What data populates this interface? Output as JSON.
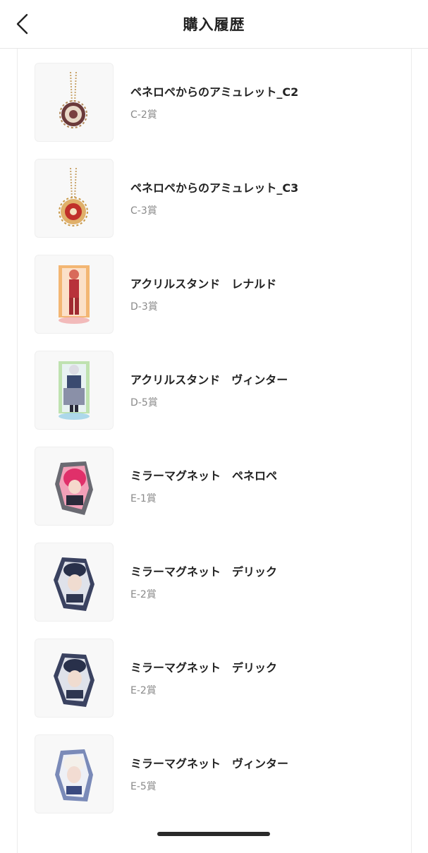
{
  "header": {
    "title": "購入履歴",
    "back_icon": "chevron-left-icon"
  },
  "items": [
    {
      "name": "ペネロペからのアミュレット_C2",
      "prize": "C-2賞",
      "image": "amulet-c2-image"
    },
    {
      "name": "ペネロペからのアミュレット_C3",
      "prize": "C-3賞",
      "image": "amulet-c3-image"
    },
    {
      "name": "アクリルスタンド　レナルド",
      "prize": "D-3賞",
      "image": "acrylic-stand-renald-image"
    },
    {
      "name": "アクリルスタンド　ヴィンター",
      "prize": "D-5賞",
      "image": "acrylic-stand-vinter-image"
    },
    {
      "name": "ミラーマグネット　ペネロペ",
      "prize": "E-1賞",
      "image": "mirror-magnet-penelope-image"
    },
    {
      "name": "ミラーマグネット　デリック",
      "prize": "E-2賞",
      "image": "mirror-magnet-derrick-image"
    },
    {
      "name": "ミラーマグネット　デリック",
      "prize": "E-2賞",
      "image": "mirror-magnet-derrick-image"
    },
    {
      "name": "ミラーマグネット　ヴィンター",
      "prize": "E-5賞",
      "image": "mirror-magnet-vinter-image"
    }
  ]
}
